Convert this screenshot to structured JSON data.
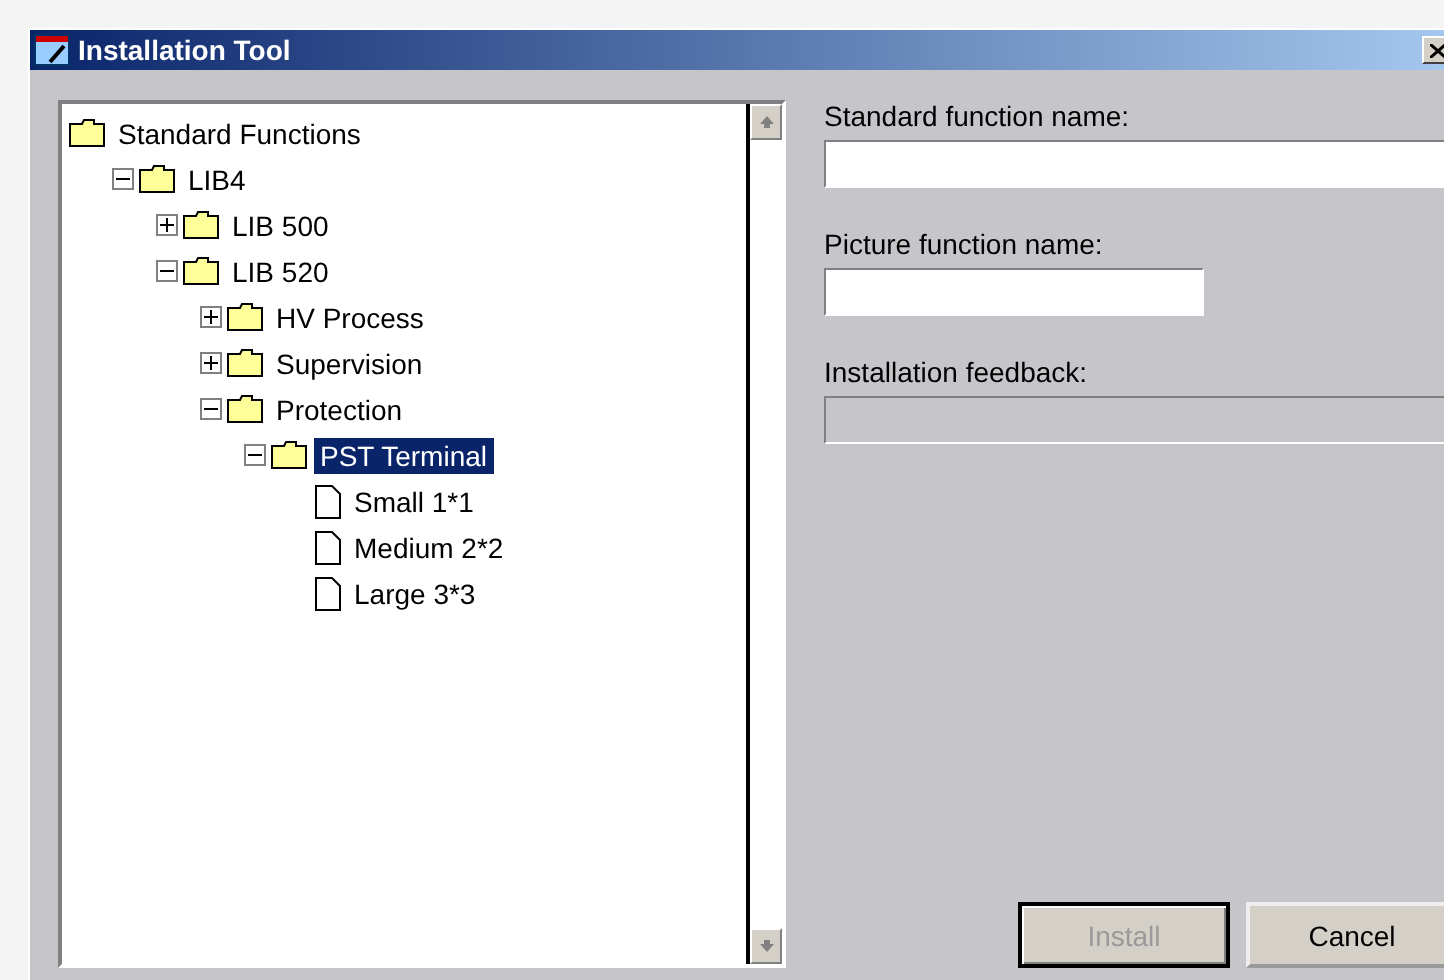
{
  "window": {
    "title": "Installation Tool"
  },
  "tree": [
    {
      "label": "Standard Functions",
      "kind": "folder",
      "selected": false,
      "children": [
        {
          "label": "LIB4",
          "kind": "folder",
          "expanded": true,
          "selected": false,
          "children": [
            {
              "label": "LIB 500",
              "kind": "folder",
              "expanded": false,
              "selected": false
            },
            {
              "label": "LIB 520",
              "kind": "folder",
              "expanded": true,
              "selected": false,
              "children": [
                {
                  "label": "HV Process",
                  "kind": "folder",
                  "expanded": false,
                  "selected": false
                },
                {
                  "label": "Supervision",
                  "kind": "folder",
                  "expanded": false,
                  "selected": false
                },
                {
                  "label": "Protection",
                  "kind": "folder",
                  "expanded": true,
                  "selected": false,
                  "children": [
                    {
                      "label": "PST Terminal",
                      "kind": "folder",
                      "expanded": true,
                      "selected": true,
                      "children": [
                        {
                          "label": "Small 1*1",
                          "kind": "document",
                          "selected": false
                        },
                        {
                          "label": "Medium 2*2",
                          "kind": "document",
                          "selected": false
                        },
                        {
                          "label": "Large 3*3",
                          "kind": "document",
                          "selected": false
                        }
                      ]
                    }
                  ]
                }
              ]
            }
          ]
        }
      ]
    }
  ],
  "fields": [
    {
      "label": "Standard function name:",
      "disabled": false
    },
    {
      "label": "Picture function name:",
      "disabled": false
    },
    {
      "label": "Installation feedback:",
      "disabled": true
    }
  ],
  "buttons": [
    {
      "label": "Install",
      "disabled": true,
      "default": true
    },
    {
      "label": "Cancel",
      "disabled": false,
      "default": false
    }
  ]
}
